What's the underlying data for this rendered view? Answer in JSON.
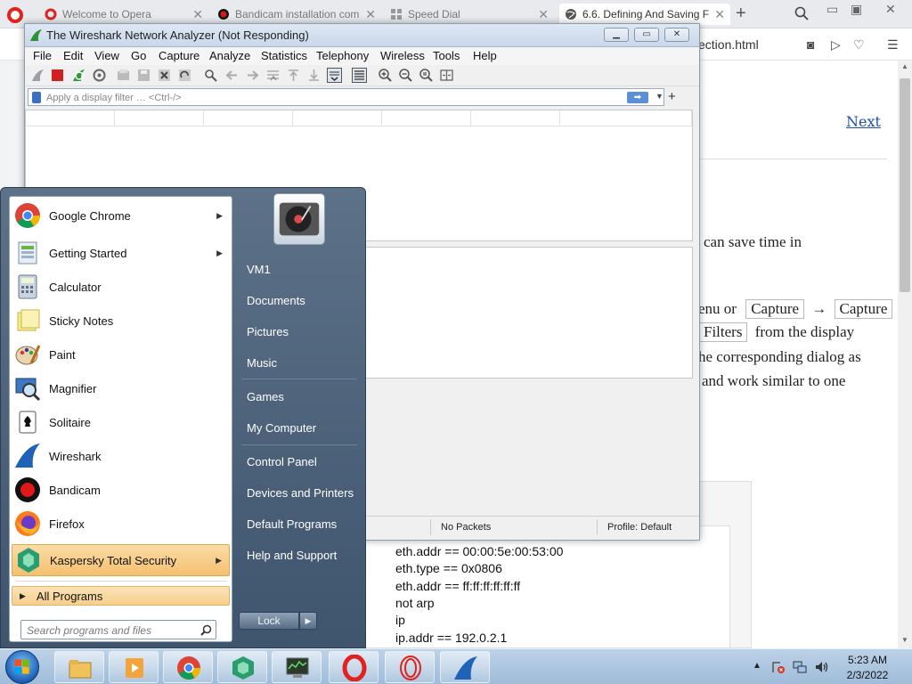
{
  "opera": {
    "tabs": [
      {
        "title": "Welcome to Opera"
      },
      {
        "title": "Bandicam installation com"
      },
      {
        "title": "Speed Dial"
      },
      {
        "title": "6.6. Defining And Saving F"
      }
    ],
    "url": "ection.html",
    "page": {
      "next_link": "Next",
      "lines": [
        "can save time in",
        "enu or",
        "Capture",
        "→",
        "Capture",
        "Filters",
        "from the display",
        "he corresponding dialog as",
        "and work similar to one"
      ],
      "filter_examples": [
        "eth.addr == 00:00:5e:00:53:00",
        "eth.type == 0x0806",
        "eth.addr == ff:ff:ff:ff:ff:ff",
        "not arp",
        "ip",
        "ip.addr == 192.0.2.1"
      ]
    }
  },
  "wireshark": {
    "title": "The Wireshark Network Analyzer (Not Responding)",
    "menu": [
      "File",
      "Edit",
      "View",
      "Go",
      "Capture",
      "Analyze",
      "Statistics",
      "Telephony",
      "Wireless",
      "Tools",
      "Help"
    ],
    "filter_placeholder": "Apply a display filter … <Ctrl-/>",
    "status": {
      "packets": "No Packets",
      "profile": "Profile: Default"
    }
  },
  "start_menu": {
    "programs": [
      {
        "label": "Google Chrome",
        "icon": "chrome-icon",
        "submenu": true
      },
      {
        "label": "Getting Started",
        "icon": "getting-started-icon",
        "submenu": true
      },
      {
        "label": "Calculator",
        "icon": "calculator-icon",
        "submenu": false
      },
      {
        "label": "Sticky Notes",
        "icon": "sticky-notes-icon",
        "submenu": false
      },
      {
        "label": "Paint",
        "icon": "paint-icon",
        "submenu": false
      },
      {
        "label": "Magnifier",
        "icon": "magnifier-icon",
        "submenu": false
      },
      {
        "label": "Solitaire",
        "icon": "solitaire-icon",
        "submenu": false
      },
      {
        "label": "Wireshark",
        "icon": "wireshark-icon",
        "submenu": false
      },
      {
        "label": "Bandicam",
        "icon": "bandicam-icon",
        "submenu": false
      },
      {
        "label": "Firefox",
        "icon": "firefox-icon",
        "submenu": false
      },
      {
        "label": "Kaspersky Total Security",
        "icon": "kaspersky-icon",
        "submenu": true
      }
    ],
    "all_programs": "All Programs",
    "search_placeholder": "Search programs and files",
    "right_items": [
      "VM1",
      "Documents",
      "Pictures",
      "Music",
      "Games",
      "My Computer",
      "Control Panel",
      "Devices and Printers",
      "Default Programs",
      "Help and Support"
    ],
    "lock_label": "Lock"
  },
  "taskbar": {
    "pinned": [
      "file-explorer-icon",
      "media-player-icon",
      "chrome-icon",
      "kaspersky-icon",
      "network-monitor-icon",
      "opera-icon",
      "opera-gx-icon",
      "wireshark-icon"
    ],
    "time": "5:23 AM",
    "date": "2/3/2022"
  },
  "colors": {
    "opera_red": "#e0231f",
    "start_menu_highlight": "#f4c070",
    "link_blue": "#1e4ea8"
  }
}
